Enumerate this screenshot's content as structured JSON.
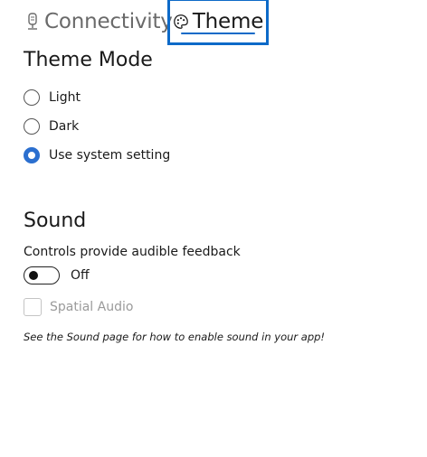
{
  "tabs": [
    {
      "label": "Connectivity",
      "icon": "microphone-icon",
      "selected": false
    },
    {
      "label": "Theme",
      "icon": "palette-icon",
      "selected": true
    }
  ],
  "theme_mode": {
    "title": "Theme Mode",
    "options": [
      {
        "label": "Light",
        "checked": false
      },
      {
        "label": "Dark",
        "checked": false
      },
      {
        "label": "Use system setting",
        "checked": true
      }
    ]
  },
  "sound": {
    "title": "Sound",
    "feedback_label": "Controls provide audible feedback",
    "toggle_state": "Off",
    "spatial_audio_label": "Spatial Audio",
    "note": "See the Sound page for how to enable sound in your app!"
  },
  "colors": {
    "accent": "#0d6ac8",
    "radio_checked": "#2b6fcf"
  }
}
